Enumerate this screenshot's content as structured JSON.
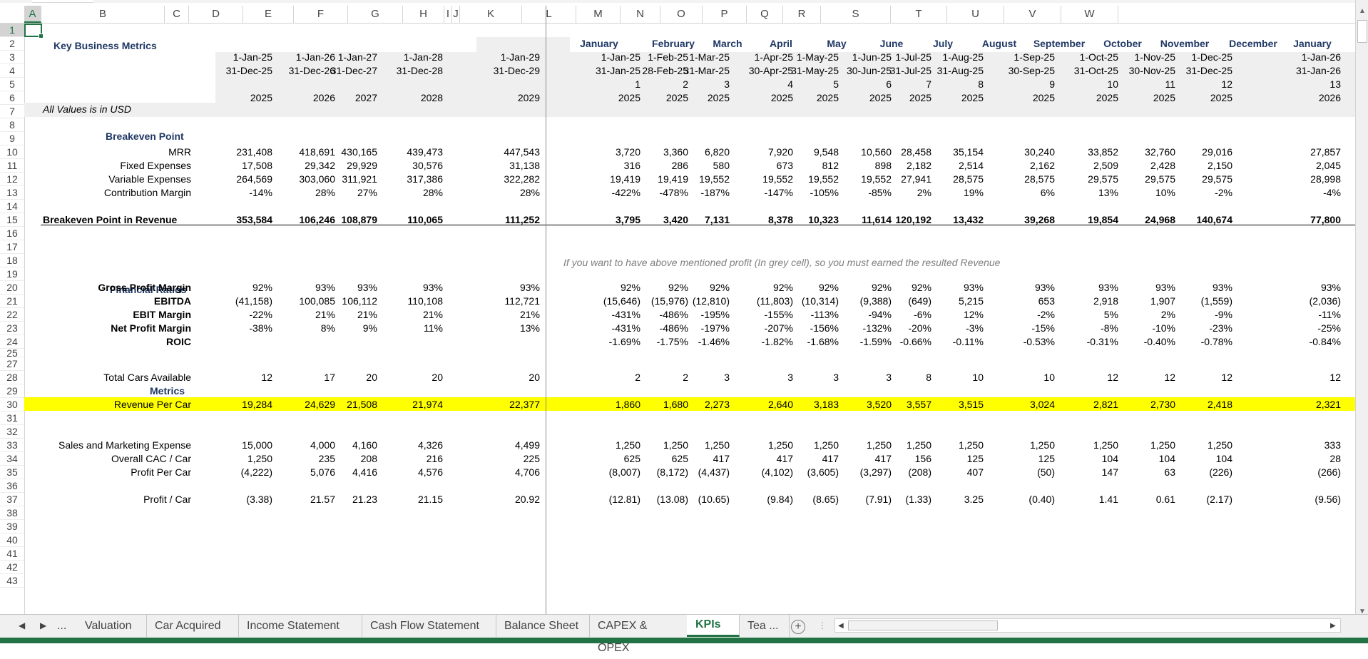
{
  "sheet": {
    "title": "Key Business Metrics",
    "currency_note": "All Values is in USD",
    "section_breakeven": "Breakeven Point",
    "section_ratios": "Financial Ratios",
    "section_metrics": "Metrics",
    "note": "If you want to have above mentioned profit (In grey cell), so you must earned the resulted Revenue"
  },
  "columns": [
    {
      "letter": "A"
    },
    {
      "letter": "B"
    },
    {
      "letter": "C"
    },
    {
      "letter": "D"
    },
    {
      "letter": "E"
    },
    {
      "letter": "F"
    },
    {
      "letter": "G"
    },
    {
      "letter": "H"
    },
    {
      "letter": "I"
    },
    {
      "letter": "J"
    },
    {
      "letter": "K"
    },
    {
      "letter": "L"
    },
    {
      "letter": "M"
    },
    {
      "letter": "N"
    },
    {
      "letter": "O"
    },
    {
      "letter": "P"
    },
    {
      "letter": "Q"
    },
    {
      "letter": "R"
    },
    {
      "letter": "S"
    },
    {
      "letter": "T"
    },
    {
      "letter": "U"
    },
    {
      "letter": "V"
    },
    {
      "letter": "W"
    }
  ],
  "rows": [
    "1",
    "2",
    "3",
    "4",
    "5",
    "6",
    "7",
    "8",
    "9",
    "10",
    "11",
    "12",
    "13",
    "14",
    "15",
    "16",
    "17",
    "18",
    "19",
    "20",
    "21",
    "22",
    "23",
    "24",
    "25",
    "27",
    "28",
    "29",
    "30",
    "31",
    "32",
    "33",
    "34",
    "35",
    "36",
    "37",
    "38",
    "39",
    "40",
    "41",
    "42",
    "43"
  ],
  "annual": {
    "start": [
      "1-Jan-25",
      "1-Jan-26",
      "1-Jan-27",
      "1-Jan-28",
      "1-Jan-29"
    ],
    "end": [
      "31-Dec-25",
      "31-Dec-26",
      "31-Dec-27",
      "31-Dec-28",
      "31-Dec-29"
    ],
    "year": [
      "2025",
      "2026",
      "2027",
      "2028",
      "2029"
    ]
  },
  "monthly": {
    "month": [
      "January",
      "February",
      "March",
      "April",
      "May",
      "June",
      "July",
      "August",
      "September",
      "October",
      "November",
      "December",
      "January"
    ],
    "start": [
      "1-Jan-25",
      "1-Feb-25",
      "1-Mar-25",
      "1-Apr-25",
      "1-May-25",
      "1-Jun-25",
      "1-Jul-25",
      "1-Aug-25",
      "1-Sep-25",
      "1-Oct-25",
      "1-Nov-25",
      "1-Dec-25",
      "1-Jan-26"
    ],
    "end": [
      "31-Jan-25",
      "28-Feb-25",
      "31-Mar-25",
      "30-Apr-25",
      "31-May-25",
      "30-Jun-25",
      "31-Jul-25",
      "31-Aug-25",
      "30-Sep-25",
      "31-Oct-25",
      "30-Nov-25",
      "31-Dec-25",
      "31-Jan-26"
    ],
    "period": [
      "1",
      "2",
      "3",
      "4",
      "5",
      "6",
      "7",
      "8",
      "9",
      "10",
      "11",
      "12",
      "13"
    ],
    "year": [
      "2025",
      "2025",
      "2025",
      "2025",
      "2025",
      "2025",
      "2025",
      "2025",
      "2025",
      "2025",
      "2025",
      "2025",
      "2026"
    ]
  },
  "lines": [
    {
      "row": "mrr",
      "label": "MRR",
      "style": "",
      "annual": [
        "231,408",
        "418,691",
        "430,165",
        "439,473",
        "447,543"
      ],
      "monthly": [
        "3,720",
        "3,360",
        "6,820",
        "7,920",
        "9,548",
        "10,560",
        "28,458",
        "35,154",
        "30,240",
        "33,852",
        "32,760",
        "29,016",
        "27,857"
      ]
    },
    {
      "row": "fixed",
      "label": "Fixed Expenses",
      "style": "",
      "annual": [
        "17,508",
        "29,342",
        "29,929",
        "30,576",
        "31,138"
      ],
      "monthly": [
        "316",
        "286",
        "580",
        "673",
        "812",
        "898",
        "2,182",
        "2,514",
        "2,162",
        "2,509",
        "2,428",
        "2,150",
        "2,045"
      ]
    },
    {
      "row": "variable",
      "label": "Variable Expenses",
      "style": "",
      "annual": [
        "264,569",
        "303,060",
        "311,921",
        "317,386",
        "322,282"
      ],
      "monthly": [
        "19,419",
        "19,419",
        "19,552",
        "19,552",
        "19,552",
        "19,552",
        "27,941",
        "28,575",
        "28,575",
        "29,575",
        "29,575",
        "29,575",
        "28,998"
      ]
    },
    {
      "row": "contribution",
      "label": "Contribution Margin",
      "style": "",
      "annual": [
        "-14%",
        "28%",
        "27%",
        "28%",
        "28%"
      ],
      "monthly": [
        "-422%",
        "-478%",
        "-187%",
        "-147%",
        "-105%",
        "-85%",
        "2%",
        "19%",
        "6%",
        "13%",
        "10%",
        "-2%",
        "-4%"
      ]
    },
    {
      "row": "breakeven",
      "label": "Breakeven Point in Revenue",
      "style": "b",
      "annual": [
        "353,584",
        "106,246",
        "108,879",
        "110,065",
        "111,252"
      ],
      "monthly": [
        "3,795",
        "3,420",
        "7,131",
        "8,378",
        "10,323",
        "11,614",
        "120,192",
        "13,432",
        "39,268",
        "19,854",
        "24,968",
        "140,674",
        "77,800"
      ]
    },
    {
      "row": "gpm",
      "label": "Gross Profit Margin",
      "style": "b",
      "annual": [
        "92%",
        "93%",
        "93%",
        "93%",
        "93%"
      ],
      "monthly": [
        "92%",
        "92%",
        "92%",
        "92%",
        "92%",
        "92%",
        "92%",
        "93%",
        "93%",
        "93%",
        "93%",
        "93%",
        "93%"
      ]
    },
    {
      "row": "ebitda",
      "label": "EBITDA",
      "style": "b",
      "annual": [
        "(41,158)",
        "100,085",
        "106,112",
        "110,108",
        "112,721"
      ],
      "monthly": [
        "(15,646)",
        "(15,976)",
        "(12,810)",
        "(11,803)",
        "(10,314)",
        "(9,388)",
        "(649)",
        "5,215",
        "653",
        "2,918",
        "1,907",
        "(1,559)",
        "(2,036)"
      ]
    },
    {
      "row": "ebit",
      "label": "EBIT Margin",
      "style": "b",
      "annual": [
        "-22%",
        "21%",
        "21%",
        "21%",
        "21%"
      ],
      "monthly": [
        "-431%",
        "-486%",
        "-195%",
        "-155%",
        "-113%",
        "-94%",
        "-6%",
        "12%",
        "-2%",
        "5%",
        "2%",
        "-9%",
        "-11%"
      ]
    },
    {
      "row": "npm",
      "label": "Net Profit Margin",
      "style": "b",
      "annual": [
        "-38%",
        "8%",
        "9%",
        "11%",
        "13%"
      ],
      "monthly": [
        "-431%",
        "-486%",
        "-197%",
        "-207%",
        "-156%",
        "-132%",
        "-20%",
        "-3%",
        "-15%",
        "-8%",
        "-10%",
        "-23%",
        "-25%"
      ]
    },
    {
      "row": "roic",
      "label": "ROIC",
      "style": "b",
      "annual": [
        "",
        "",
        "",
        "",
        ""
      ],
      "monthly": [
        "-1.69%",
        "-1.75%",
        "-1.46%",
        "-1.82%",
        "-1.68%",
        "-1.59%",
        "-0.66%",
        "-0.11%",
        "-0.53%",
        "-0.31%",
        "-0.40%",
        "-0.78%",
        "-0.84%"
      ]
    },
    {
      "row": "cars",
      "label": "Total Cars Available",
      "style": "",
      "annual": [
        "12",
        "17",
        "20",
        "20",
        "20"
      ],
      "monthly": [
        "2",
        "2",
        "3",
        "3",
        "3",
        "3",
        "8",
        "10",
        "10",
        "12",
        "12",
        "12",
        "12"
      ]
    },
    {
      "row": "revcar",
      "label": "Revenue Per Car",
      "style": "",
      "annual": [
        "19,284",
        "24,629",
        "21,508",
        "21,974",
        "22,377"
      ],
      "monthly": [
        "1,860",
        "1,680",
        "2,273",
        "2,640",
        "3,183",
        "3,520",
        "3,557",
        "3,515",
        "3,024",
        "2,821",
        "2,730",
        "2,418",
        "2,321"
      ]
    },
    {
      "row": "smexp",
      "label": "Sales and Marketing Expense",
      "style": "",
      "annual": [
        "15,000",
        "4,000",
        "4,160",
        "4,326",
        "4,499"
      ],
      "monthly": [
        "1,250",
        "1,250",
        "1,250",
        "1,250",
        "1,250",
        "1,250",
        "1,250",
        "1,250",
        "1,250",
        "1,250",
        "1,250",
        "1,250",
        "333"
      ]
    },
    {
      "row": "cac",
      "label": "Overall CAC / Car",
      "style": "",
      "annual": [
        "1,250",
        "235",
        "208",
        "216",
        "225"
      ],
      "monthly": [
        "625",
        "625",
        "417",
        "417",
        "417",
        "417",
        "156",
        "125",
        "125",
        "104",
        "104",
        "104",
        "28"
      ]
    },
    {
      "row": "profitcar",
      "label": "Profit Per Car",
      "style": "",
      "annual": [
        "(4,222)",
        "5,076",
        "4,416",
        "4,576",
        "4,706"
      ],
      "monthly": [
        "(8,007)",
        "(8,172)",
        "(4,437)",
        "(4,102)",
        "(3,605)",
        "(3,297)",
        "(208)",
        "407",
        "(50)",
        "147",
        "63",
        "(226)",
        "(266)"
      ]
    },
    {
      "row": "profitslash",
      "label": "Profit / Car",
      "style": "",
      "annual": [
        "(3.38)",
        "21.57",
        "21.23",
        "21.15",
        "20.92"
      ],
      "monthly": [
        "(12.81)",
        "(13.08)",
        "(10.65)",
        "(9.84)",
        "(8.65)",
        "(7.91)",
        "(1.33)",
        "3.25",
        "(0.40)",
        "1.41",
        "0.61",
        "(2.17)",
        "(9.56)"
      ]
    }
  ],
  "tabs": {
    "ellipsis": "...",
    "items": [
      "Valuation",
      "Car Acquired",
      "Income Statement",
      "Cash Flow Statement",
      "Balance Sheet",
      "CAPEX & OPEX",
      "KPIs",
      "Tea ..."
    ],
    "active": "KPIs",
    "add": "+"
  },
  "colors": {
    "accent": "#217346",
    "highlight": "#ffff00",
    "header_blue": "#1f3864",
    "note_grey": "#7f7f7f"
  }
}
